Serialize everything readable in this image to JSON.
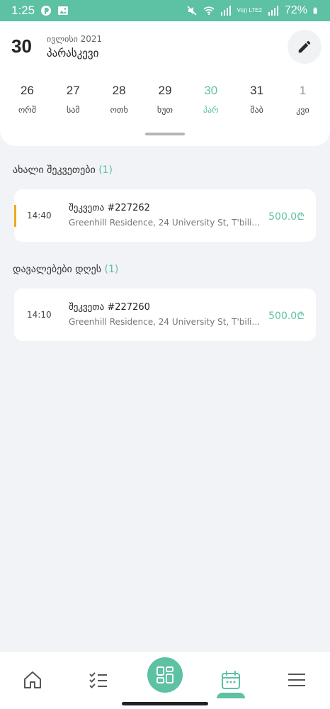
{
  "status_bar": {
    "time": "1:25",
    "battery": "72%",
    "network_label": "Vo)) LTE2"
  },
  "header": {
    "day": "30",
    "month_year": "ივლისი 2021",
    "weekday": "პარასკევი",
    "edit_icon": "pencil-icon"
  },
  "week": [
    {
      "num": "26",
      "label": "ორშ"
    },
    {
      "num": "27",
      "label": "სამ"
    },
    {
      "num": "28",
      "label": "ოთხ"
    },
    {
      "num": "29",
      "label": "ხუთ"
    },
    {
      "num": "30",
      "label": "პარ",
      "selected": true
    },
    {
      "num": "31",
      "label": "შაბ"
    },
    {
      "num": "1",
      "label": "კვი",
      "other_month": true
    }
  ],
  "sections": {
    "new_orders": {
      "title": "ახალი შეკვეთები",
      "count": "(1)",
      "items": [
        {
          "time": "14:40",
          "title": "შეკვეთა #227262",
          "address": "Greenhill Residence, 24 University St, T'bilisi, Georgia",
          "price": "500.0₾"
        }
      ]
    },
    "today_tasks": {
      "title": "დავალებები დღეს",
      "count": "(1)",
      "items": [
        {
          "time": "14:10",
          "title": "შეკვეთა #227260",
          "address": "Greenhill Residence, 24 University St, T'bilisi, Georgia",
          "price": "500.0₾"
        }
      ]
    }
  },
  "bottom_nav": {
    "items": [
      "home-icon",
      "checklist-icon",
      "dashboard-icon",
      "calendar-icon",
      "menu-icon"
    ],
    "active": "calendar-icon"
  },
  "colors": {
    "accent": "#5dc1a3",
    "new_order_marker": "#f0a818",
    "background": "#f2f3f7"
  }
}
